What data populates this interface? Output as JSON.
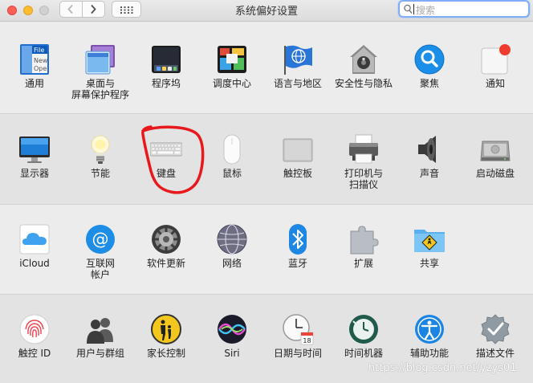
{
  "window": {
    "title": "系统偏好设置"
  },
  "search": {
    "placeholder": "搜索"
  },
  "rows": [
    [
      {
        "name": "general",
        "label": "通用"
      },
      {
        "name": "desktop-screensaver",
        "label": "桌面与\n屏幕保护程序"
      },
      {
        "name": "dock",
        "label": "程序坞"
      },
      {
        "name": "mission-control",
        "label": "调度中心"
      },
      {
        "name": "language-region",
        "label": "语言与地区"
      },
      {
        "name": "security-privacy",
        "label": "安全性与隐私"
      },
      {
        "name": "spotlight",
        "label": "聚焦"
      },
      {
        "name": "notifications",
        "label": "通知"
      }
    ],
    [
      {
        "name": "displays",
        "label": "显示器"
      },
      {
        "name": "energy-saver",
        "label": "节能"
      },
      {
        "name": "keyboard",
        "label": "键盘"
      },
      {
        "name": "mouse",
        "label": "鼠标"
      },
      {
        "name": "trackpad",
        "label": "触控板"
      },
      {
        "name": "printers-scanners",
        "label": "打印机与\n扫描仪"
      },
      {
        "name": "sound",
        "label": "声音"
      },
      {
        "name": "startup-disk",
        "label": "启动磁盘"
      }
    ],
    [
      {
        "name": "icloud",
        "label": "iCloud"
      },
      {
        "name": "internet-accounts",
        "label": "互联网\n帐户"
      },
      {
        "name": "software-update",
        "label": "软件更新"
      },
      {
        "name": "network",
        "label": "网络"
      },
      {
        "name": "bluetooth",
        "label": "蓝牙"
      },
      {
        "name": "extensions",
        "label": "扩展"
      },
      {
        "name": "sharing",
        "label": "共享"
      }
    ],
    [
      {
        "name": "touch-id",
        "label": "触控 ID"
      },
      {
        "name": "users-groups",
        "label": "用户与群组"
      },
      {
        "name": "parental-controls",
        "label": "家长控制"
      },
      {
        "name": "siri",
        "label": "Siri"
      },
      {
        "name": "date-time",
        "label": "日期与时间"
      },
      {
        "name": "time-machine",
        "label": "时间机器"
      },
      {
        "name": "accessibility",
        "label": "辅助功能"
      },
      {
        "name": "profiles",
        "label": "描述文件"
      }
    ]
  ],
  "icon_text": {
    "general": [
      "File",
      "New",
      "Ope"
    ],
    "calendar_day": "18"
  },
  "watermark": "https://blog.csdn.net/yzys01",
  "colors": {
    "annotation": "#e8191c",
    "search_focus": "#7fadf6"
  }
}
